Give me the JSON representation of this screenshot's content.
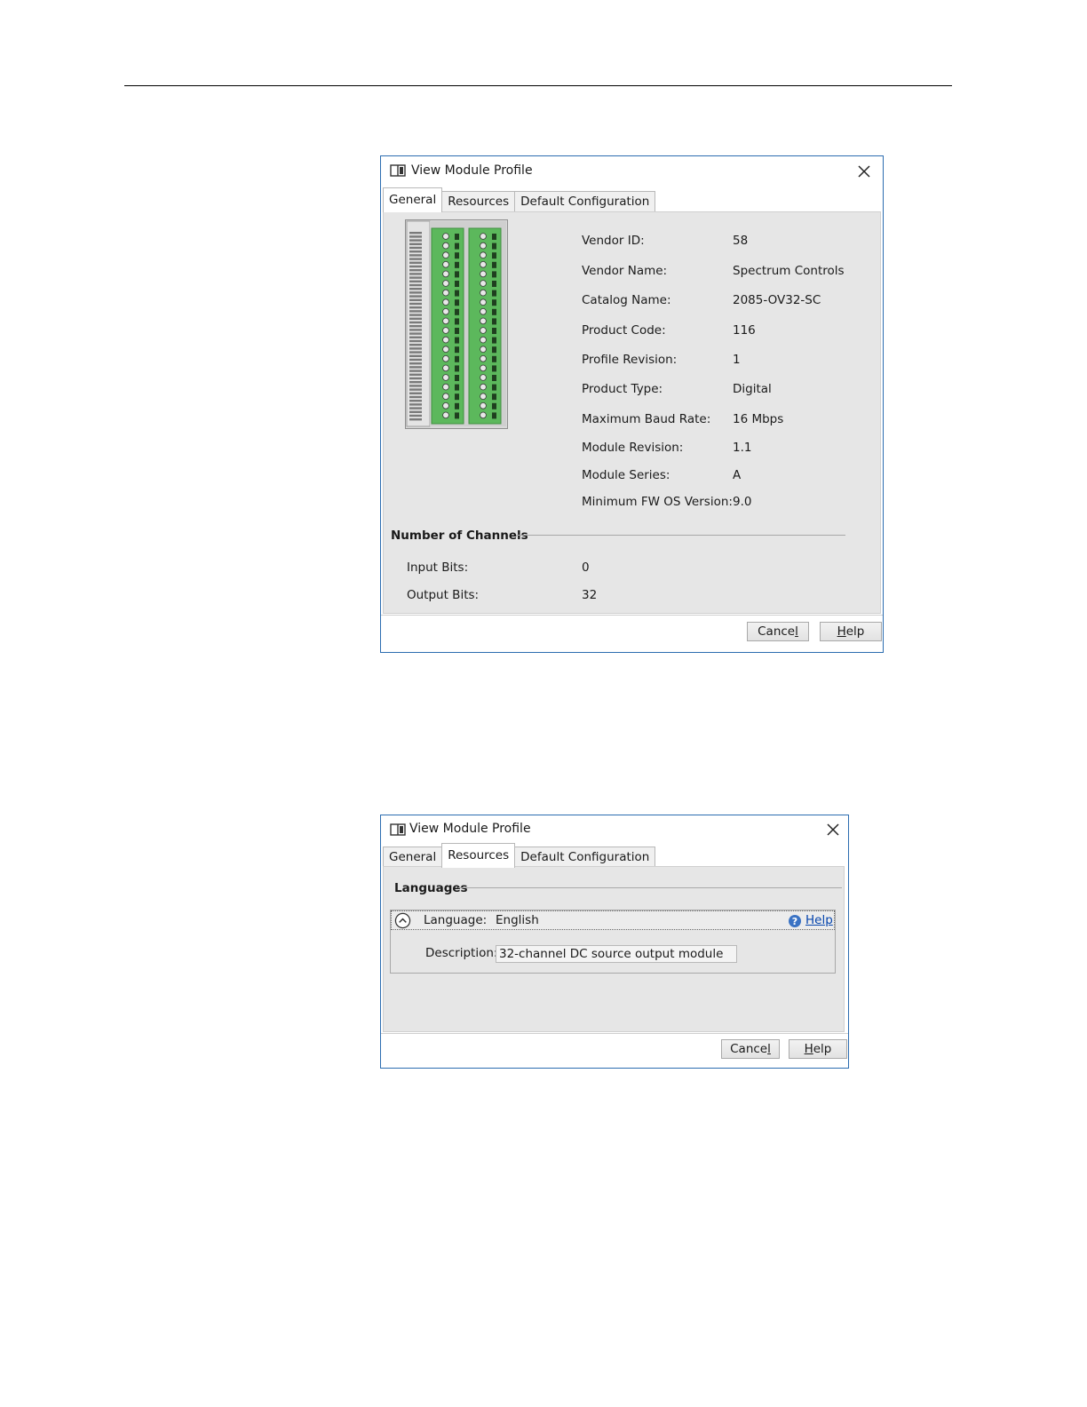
{
  "dialog1": {
    "title": "View Module Profile",
    "tabs": [
      {
        "label": "General",
        "active": true
      },
      {
        "label": "Resources",
        "active": false
      },
      {
        "label": "Default Configuration",
        "active": false
      }
    ],
    "fields": [
      {
        "label": "Vendor ID:",
        "value": "58"
      },
      {
        "label": "Vendor Name:",
        "value": "Spectrum Controls"
      },
      {
        "label": "Catalog Name:",
        "value": "2085-OV32-SC"
      },
      {
        "label": "Product Code:",
        "value": "116"
      },
      {
        "label": "Profile Revision:",
        "value": "1"
      },
      {
        "label": "Product Type:",
        "value": "Digital"
      },
      {
        "label": "Maximum Baud Rate:",
        "value": "16 Mbps"
      },
      {
        "label": "Module Revision:",
        "value": "1.1"
      },
      {
        "label": "Module Series:",
        "value": "A"
      },
      {
        "label": "Minimum FW OS Version:",
        "value": "9.0"
      }
    ],
    "channels_title": "Number of Channels",
    "channels": [
      {
        "label": "Input Bits:",
        "value": "0"
      },
      {
        "label": "Output Bits:",
        "value": "32"
      }
    ],
    "cancel_prefix": "Cance",
    "cancel_accel": "l",
    "help_accel": "H",
    "help_suffix": "elp"
  },
  "dialog2": {
    "title": "View Module Profile",
    "tabs": [
      {
        "label": "General",
        "active": false
      },
      {
        "label": "Resources",
        "active": true
      },
      {
        "label": "Default Configuration",
        "active": false
      }
    ],
    "languages_title": "Languages",
    "language_label": "Language:",
    "language_value": "English",
    "help_link": "Help",
    "description_label": "Description:",
    "description_value": "32-channel DC source output module",
    "cancel_prefix": "Cance",
    "cancel_accel": "l",
    "help_accel": "H",
    "help_suffix": "elp"
  },
  "colors": {
    "dialog_border": "#2b6cb0",
    "panel_bg": "#e6e6e6",
    "terminal_green": "#5cb85c",
    "link_blue": "#0645ad"
  }
}
